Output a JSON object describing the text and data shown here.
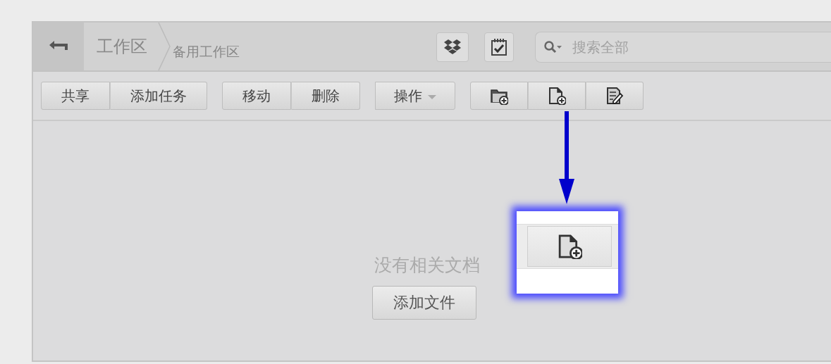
{
  "header": {
    "breadcrumbs": [
      "工作区",
      "备用工作区"
    ],
    "search": {
      "placeholder": "搜索全部"
    }
  },
  "toolbar": {
    "groups": [
      {
        "kind": "text",
        "buttons": [
          {
            "label": "共享"
          },
          {
            "label": "添加任务"
          }
        ]
      },
      {
        "kind": "text",
        "buttons": [
          {
            "label": "移动"
          },
          {
            "label": "删除"
          }
        ]
      },
      {
        "kind": "dropdown",
        "buttons": [
          {
            "label": "操作"
          }
        ]
      }
    ]
  },
  "empty_state": {
    "message": "没有相关文档",
    "button": "添加文件"
  }
}
